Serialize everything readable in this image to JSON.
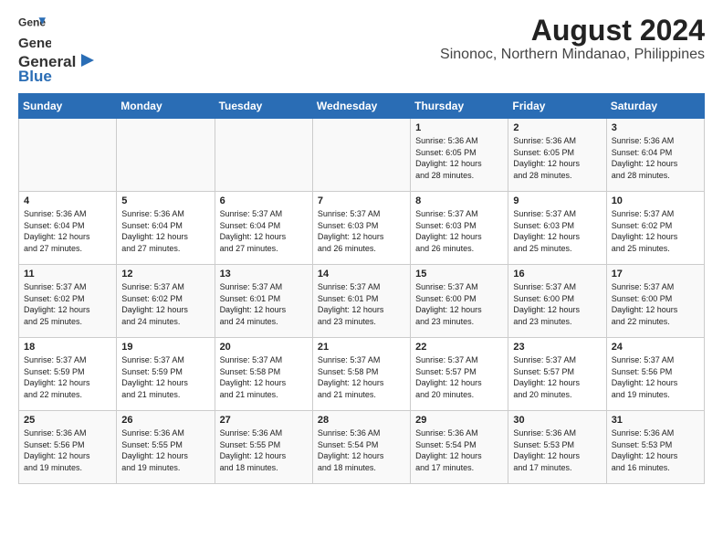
{
  "header": {
    "logo_line1": "General",
    "logo_line2": "Blue",
    "title": "August 2024",
    "subtitle": "Sinonoc, Northern Mindanao, Philippines"
  },
  "days_of_week": [
    "Sunday",
    "Monday",
    "Tuesday",
    "Wednesday",
    "Thursday",
    "Friday",
    "Saturday"
  ],
  "weeks": [
    [
      {
        "day": "",
        "info": ""
      },
      {
        "day": "",
        "info": ""
      },
      {
        "day": "",
        "info": ""
      },
      {
        "day": "",
        "info": ""
      },
      {
        "day": "1",
        "info": "Sunrise: 5:36 AM\nSunset: 6:05 PM\nDaylight: 12 hours\nand 28 minutes."
      },
      {
        "day": "2",
        "info": "Sunrise: 5:36 AM\nSunset: 6:05 PM\nDaylight: 12 hours\nand 28 minutes."
      },
      {
        "day": "3",
        "info": "Sunrise: 5:36 AM\nSunset: 6:04 PM\nDaylight: 12 hours\nand 28 minutes."
      }
    ],
    [
      {
        "day": "4",
        "info": "Sunrise: 5:36 AM\nSunset: 6:04 PM\nDaylight: 12 hours\nand 27 minutes."
      },
      {
        "day": "5",
        "info": "Sunrise: 5:36 AM\nSunset: 6:04 PM\nDaylight: 12 hours\nand 27 minutes."
      },
      {
        "day": "6",
        "info": "Sunrise: 5:37 AM\nSunset: 6:04 PM\nDaylight: 12 hours\nand 27 minutes."
      },
      {
        "day": "7",
        "info": "Sunrise: 5:37 AM\nSunset: 6:03 PM\nDaylight: 12 hours\nand 26 minutes."
      },
      {
        "day": "8",
        "info": "Sunrise: 5:37 AM\nSunset: 6:03 PM\nDaylight: 12 hours\nand 26 minutes."
      },
      {
        "day": "9",
        "info": "Sunrise: 5:37 AM\nSunset: 6:03 PM\nDaylight: 12 hours\nand 25 minutes."
      },
      {
        "day": "10",
        "info": "Sunrise: 5:37 AM\nSunset: 6:02 PM\nDaylight: 12 hours\nand 25 minutes."
      }
    ],
    [
      {
        "day": "11",
        "info": "Sunrise: 5:37 AM\nSunset: 6:02 PM\nDaylight: 12 hours\nand 25 minutes."
      },
      {
        "day": "12",
        "info": "Sunrise: 5:37 AM\nSunset: 6:02 PM\nDaylight: 12 hours\nand 24 minutes."
      },
      {
        "day": "13",
        "info": "Sunrise: 5:37 AM\nSunset: 6:01 PM\nDaylight: 12 hours\nand 24 minutes."
      },
      {
        "day": "14",
        "info": "Sunrise: 5:37 AM\nSunset: 6:01 PM\nDaylight: 12 hours\nand 23 minutes."
      },
      {
        "day": "15",
        "info": "Sunrise: 5:37 AM\nSunset: 6:00 PM\nDaylight: 12 hours\nand 23 minutes."
      },
      {
        "day": "16",
        "info": "Sunrise: 5:37 AM\nSunset: 6:00 PM\nDaylight: 12 hours\nand 23 minutes."
      },
      {
        "day": "17",
        "info": "Sunrise: 5:37 AM\nSunset: 6:00 PM\nDaylight: 12 hours\nand 22 minutes."
      }
    ],
    [
      {
        "day": "18",
        "info": "Sunrise: 5:37 AM\nSunset: 5:59 PM\nDaylight: 12 hours\nand 22 minutes."
      },
      {
        "day": "19",
        "info": "Sunrise: 5:37 AM\nSunset: 5:59 PM\nDaylight: 12 hours\nand 21 minutes."
      },
      {
        "day": "20",
        "info": "Sunrise: 5:37 AM\nSunset: 5:58 PM\nDaylight: 12 hours\nand 21 minutes."
      },
      {
        "day": "21",
        "info": "Sunrise: 5:37 AM\nSunset: 5:58 PM\nDaylight: 12 hours\nand 21 minutes."
      },
      {
        "day": "22",
        "info": "Sunrise: 5:37 AM\nSunset: 5:57 PM\nDaylight: 12 hours\nand 20 minutes."
      },
      {
        "day": "23",
        "info": "Sunrise: 5:37 AM\nSunset: 5:57 PM\nDaylight: 12 hours\nand 20 minutes."
      },
      {
        "day": "24",
        "info": "Sunrise: 5:37 AM\nSunset: 5:56 PM\nDaylight: 12 hours\nand 19 minutes."
      }
    ],
    [
      {
        "day": "25",
        "info": "Sunrise: 5:36 AM\nSunset: 5:56 PM\nDaylight: 12 hours\nand 19 minutes."
      },
      {
        "day": "26",
        "info": "Sunrise: 5:36 AM\nSunset: 5:55 PM\nDaylight: 12 hours\nand 19 minutes."
      },
      {
        "day": "27",
        "info": "Sunrise: 5:36 AM\nSunset: 5:55 PM\nDaylight: 12 hours\nand 18 minutes."
      },
      {
        "day": "28",
        "info": "Sunrise: 5:36 AM\nSunset: 5:54 PM\nDaylight: 12 hours\nand 18 minutes."
      },
      {
        "day": "29",
        "info": "Sunrise: 5:36 AM\nSunset: 5:54 PM\nDaylight: 12 hours\nand 17 minutes."
      },
      {
        "day": "30",
        "info": "Sunrise: 5:36 AM\nSunset: 5:53 PM\nDaylight: 12 hours\nand 17 minutes."
      },
      {
        "day": "31",
        "info": "Sunrise: 5:36 AM\nSunset: 5:53 PM\nDaylight: 12 hours\nand 16 minutes."
      }
    ]
  ]
}
